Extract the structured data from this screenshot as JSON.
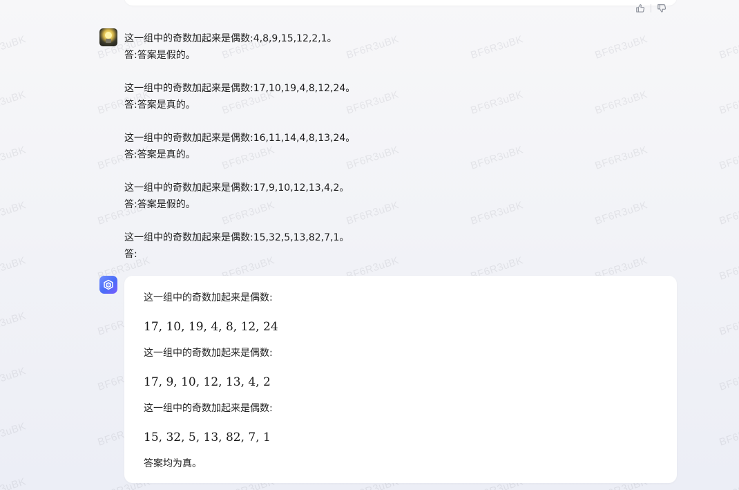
{
  "watermark": {
    "text": "BF6R3uBK"
  },
  "feedback": {
    "like_icon": "thumbs-up-icon",
    "dislike_icon": "thumbs-down-icon"
  },
  "user_message": {
    "avatar_icon": "light-bulb-avatar",
    "lines": [
      "这一组中的奇数加起来是偶数:4,8,9,15,12,2,1。",
      "答:答案是假的。",
      "",
      "这一组中的奇数加起来是偶数:17,10,19,4,8,12,24。",
      "答:答案是真的。",
      "",
      "这一组中的奇数加起来是偶数:16,11,14,4,8,13,24。",
      "答:答案是真的。",
      "",
      "这一组中的奇数加起来是偶数:17,9,10,12,13,4,2。",
      "答:答案是假的。",
      "",
      "这一组中的奇数加起来是偶数:15,32,5,13,82,7,1。",
      "答:"
    ]
  },
  "bot_message": {
    "avatar_icon": "cube-bot-icon",
    "blocks": [
      {
        "label": "这一组中的奇数加起来是偶数:",
        "numbers": "17, 10, 19, 4, 8, 12, 24"
      },
      {
        "label": "这一组中的奇数加起来是偶数:",
        "numbers": "17, 9, 10, 12, 13, 4, 2"
      },
      {
        "label": "这一组中的奇数加起来是偶数:",
        "numbers": "15, 32, 5, 13, 82, 7, 1"
      }
    ],
    "conclusion": "答案均为真。"
  },
  "colors": {
    "accent": "#4a6cf7",
    "text": "#1f1f1f",
    "card_bg": "#ffffff",
    "page_bg": "#f2f3f7"
  }
}
